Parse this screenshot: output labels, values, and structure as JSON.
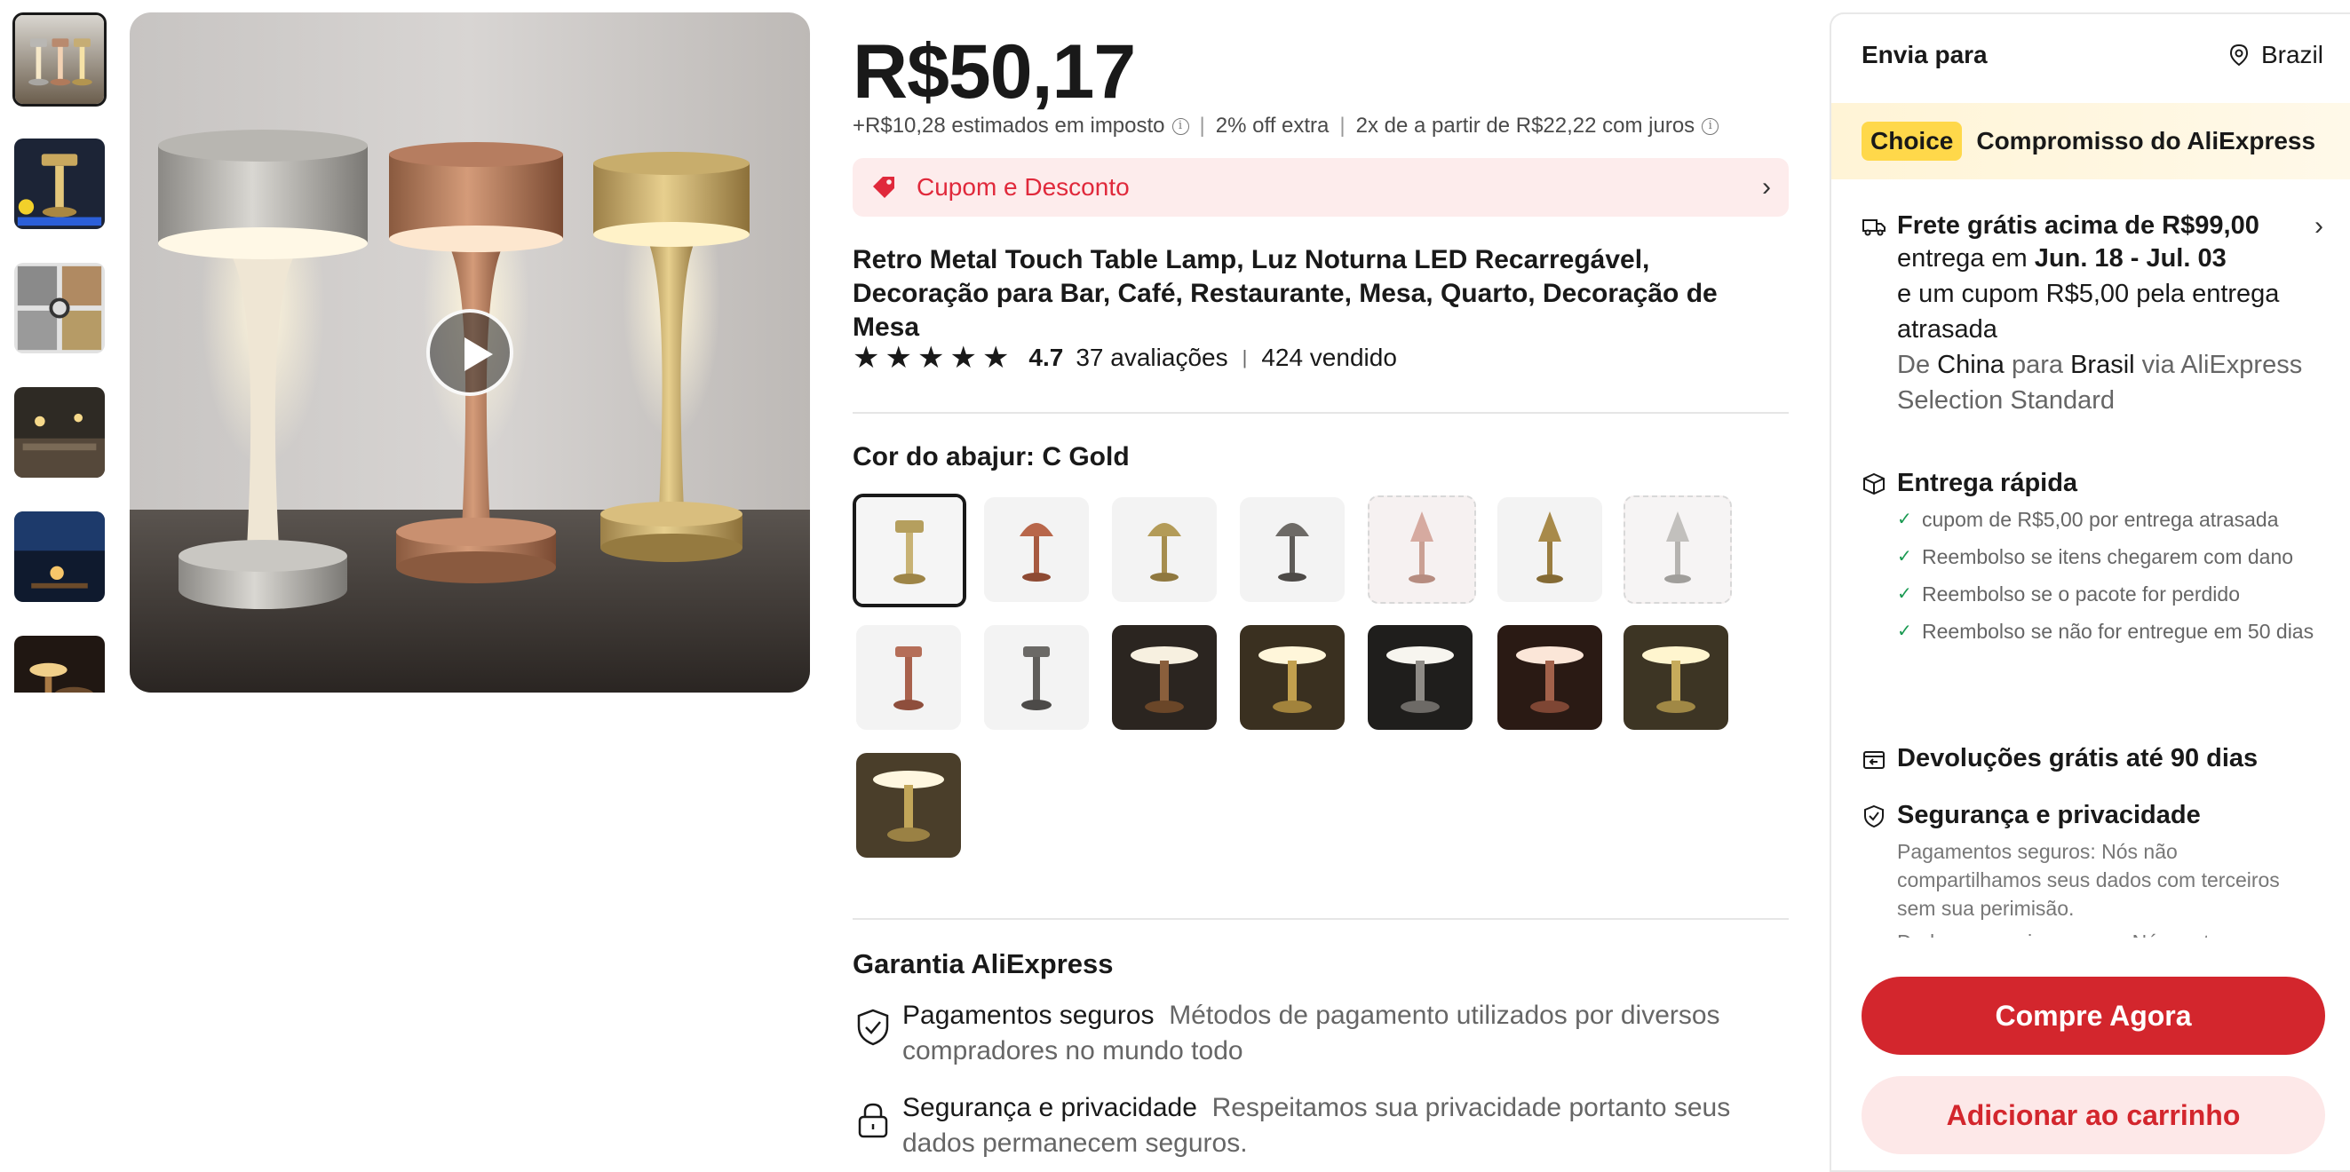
{
  "product": {
    "price": "R$50,17",
    "tax_note": "+R$10,28 estimados em imposto",
    "extra_off": "2% off extra",
    "installments": "2x de a partir de R$22,22 com juros",
    "coupon_label": "Cupom e Desconto",
    "title": "Retro Metal Touch Table Lamp, Luz Noturna LED Recarregável, Decoração para Bar, Café, Restaurante, Mesa, Quarto, Decoração de Mesa",
    "rating": "4.7",
    "reviews": "37 avaliações",
    "sold": "424 vendido",
    "stars": 4.7
  },
  "variant": {
    "label": "Cor do abajur: C Gold",
    "selected_index": 0
  },
  "warranty": {
    "title": "Garantia AliExpress",
    "items": [
      {
        "title": "Pagamentos seguros",
        "desc": "Métodos de pagamento utilizados por diversos compradores no mundo todo"
      },
      {
        "title": "Segurança e privacidade",
        "desc": "Respeitamos sua privacidade portanto seus dados permanecem seguros."
      }
    ]
  },
  "shipping": {
    "ships_to_label": "Envia para",
    "country": "Brazil",
    "choice_badge": "Choice",
    "choice_text": "Compromisso do AliExpress",
    "free_shipping": "Frete grátis acima de R$99,00",
    "delivery_prefix": "entrega em ",
    "delivery_dates": "Jun. 18 - Jul. 03",
    "late_coupon": "e um cupom R$5,00 pela entrega atrasada",
    "route": {
      "de": "De",
      "from": "China",
      "para": "para",
      "to": "Brasil",
      "via": "via",
      "carrier": "AliExpress Selection Standard"
    },
    "fast_delivery": "Entrega rápida",
    "fast_items": [
      "cupom de R$5,00 por entrega atrasada",
      "Reembolso se itens chegarem com dano",
      "Reembolso se o pacote for perdido",
      "Reembolso se não for entregue em 50 dias"
    ],
    "returns": "Devoluções grátis até 90 dias",
    "security_title": "Segurança e privacidade",
    "security_desc_1": "Pagamentos seguros: Nós não compartilhamos seus dados com terceiros sem sua perimisão.",
    "security_desc_2": "Dados pessoais seguros: Nós protegemos"
  },
  "actions": {
    "buy_now": "Compre Agora",
    "add_to_cart": "Adicionar ao carrinho"
  },
  "colors": {
    "accent_red": "#d3262d",
    "coupon_red": "#e0293b",
    "choice_yellow": "#ffd84a",
    "check_green": "#1a9a52"
  }
}
